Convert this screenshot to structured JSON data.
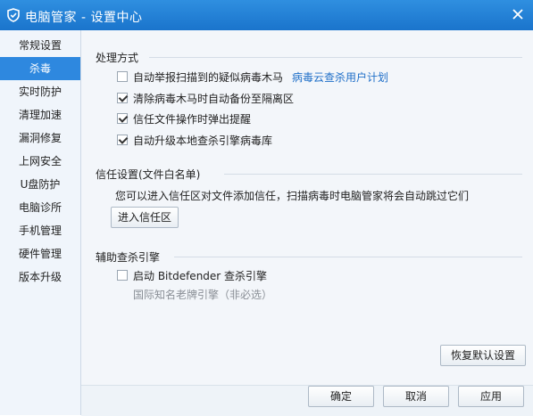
{
  "window": {
    "title": "电脑管家 - 设置中心"
  },
  "sidebar": {
    "items": [
      {
        "label": "常规设置"
      },
      {
        "label": "杀毒",
        "active": true
      },
      {
        "label": "实时防护"
      },
      {
        "label": "清理加速"
      },
      {
        "label": "漏洞修复"
      },
      {
        "label": "上网安全"
      },
      {
        "label": "U盘防护"
      },
      {
        "label": "电脑诊所"
      },
      {
        "label": "手机管理"
      },
      {
        "label": "硬件管理"
      },
      {
        "label": "版本升级"
      }
    ]
  },
  "handling": {
    "title": "处理方式",
    "options": [
      {
        "label": "自动举报扫描到的疑似病毒木马",
        "checked": false,
        "link": "病毒云查杀用户计划"
      },
      {
        "label": "清除病毒木马时自动备份至隔离区",
        "checked": true
      },
      {
        "label": "信任文件操作时弹出提醒",
        "checked": true
      },
      {
        "label": "自动升级本地查杀引擎病毒库",
        "checked": true
      }
    ]
  },
  "trust": {
    "title": "信任设置(文件白名单)",
    "description": "您可以进入信任区对文件添加信任，扫描病毒时电脑管家将会自动跳过它们",
    "button": "进入信任区"
  },
  "engine": {
    "title": "辅助查杀引擎",
    "option_label": "启动 Bitdefender 查杀引擎",
    "option_checked": false,
    "note": "国际知名老牌引擎（非必选）"
  },
  "buttons": {
    "restore": "恢复默认设置",
    "ok": "确定",
    "cancel": "取消",
    "apply": "应用"
  },
  "colors": {
    "accent": "#2e88df",
    "link": "#1f6fc8"
  }
}
